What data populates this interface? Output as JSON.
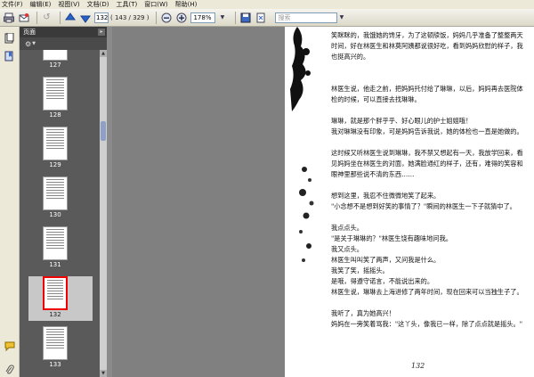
{
  "menu": [
    "文件(F)",
    "编辑(E)",
    "视图(V)",
    "文档(D)",
    "工具(T)",
    "窗口(W)",
    "帮助(H)"
  ],
  "toolbar": {
    "current_page": "132",
    "page_total": "( 143 / 329 )",
    "zoom": "178%",
    "search_placeholder": "搜索"
  },
  "panel": {
    "title": "页面",
    "thumbnails": [
      {
        "label": "127"
      },
      {
        "label": "128"
      },
      {
        "label": "129"
      },
      {
        "label": "130"
      },
      {
        "label": "131"
      },
      {
        "label": "132",
        "selected": true
      },
      {
        "label": "133"
      }
    ]
  },
  "document": {
    "page_number": "132",
    "paragraphs": [
      "笑眯眯的，我饿她的馋牙，为了这顿牍饭，妈妈几乎准备了整整两天时间，好在林医生和林莫阿姨都说很好吃，看到妈妈欣慰的样子，我也挺高兴的。",
      "林医生说，他走之前，把妈妈托付给了琳琳，以后，妈妈再去医院体检的时候，可以直接去找琳琳。",
      "琳琳，就是那个胖乎乎、好心眼儿的护士姐姐哦！",
      "我对琳琳没有印象，可是妈妈告诉我说，她的体检也一直是她做的。",
      "这时候又听林医生说到琳琳，我不禁又想起有一天，我放学回来，看见妈妈坐在林医生的对面，她满脸通红的样子，还有，难得的笑容和眼神里那些说不清的东西……",
      "想到这里，我忍不住微微地笑了起来。",
      "\"小念想不是想到好笑的事情了？\"瞬间的林医生一下子就猜中了。",
      "我点点头。",
      "\"是关于琳琳的？\"林医生饶有趣味地问我。",
      "我又点头。",
      "林医生叫叫笑了两声，又问我是什么。",
      "我笑了笑，摇摇头。",
      "是哦，得遵守诺言，不能说出来的。",
      "林医生说，琳琳去上海进修了两年时间，现在回来可以当独生子了。",
      "我听了，真为她高兴！",
      "妈妈在一旁笑着骂我：\"这丫头，像我已一样，除了点点就是摇头。\""
    ]
  }
}
